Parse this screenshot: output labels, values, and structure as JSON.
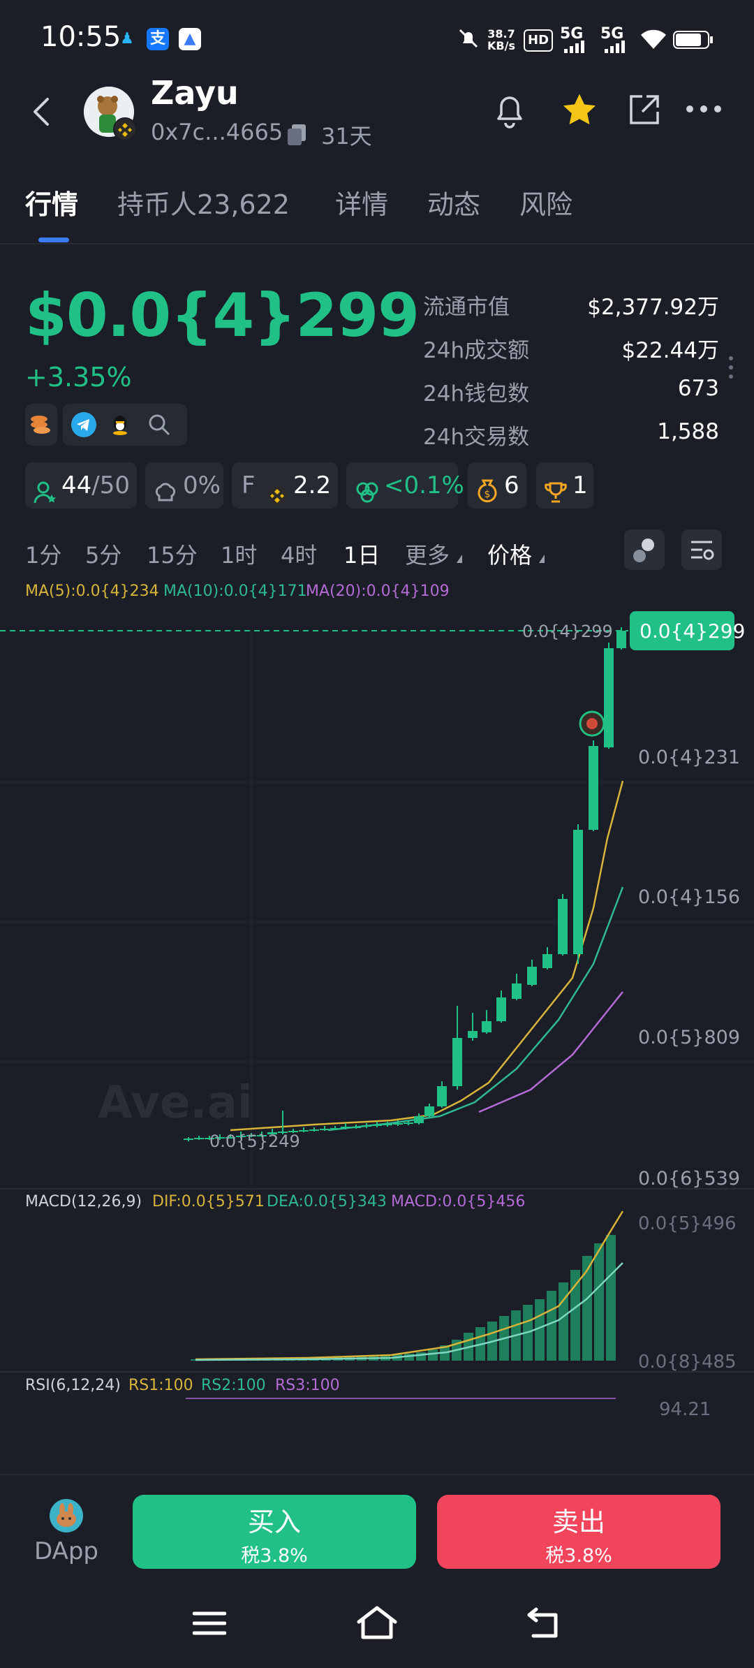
{
  "status_bar": {
    "time": "10:55",
    "net_speed_top": "38.7",
    "net_speed_bottom": "KB/s",
    "hd": "HD",
    "sim1": "5G",
    "sim2": "5G"
  },
  "header": {
    "token_name": "Zayu",
    "address": "0x7c...4665",
    "age": "31天"
  },
  "tabs": [
    {
      "label": "行情"
    },
    {
      "label": "持币人23,622"
    },
    {
      "label": "详情"
    },
    {
      "label": "动态"
    },
    {
      "label": "风险"
    }
  ],
  "market": {
    "price": "$0.0{4}299",
    "change": "+3.35%",
    "stats": [
      {
        "label": "流通市值",
        "value": "$2,377.92万"
      },
      {
        "label": "24h成交额",
        "value": "$22.44万"
      },
      {
        "label": "24h钱包数",
        "value": "673"
      },
      {
        "label": "24h交易数",
        "value": "1,588"
      }
    ]
  },
  "pills": {
    "holders": "44",
    "holders_total": "/50",
    "dev_pct": "0%",
    "f_label": "F",
    "f_value": "2.2",
    "bundle_pct": "<0.1%",
    "money_count": "6",
    "trophy_count": "1"
  },
  "timeframes": [
    "1分",
    "5分",
    "15分",
    "1时",
    "4时",
    "1日",
    "更多",
    "价格"
  ],
  "active_timeframe": "1日",
  "ma": {
    "ma5": "MA(5):0.0{4}234",
    "ma10": "MA(10):0.0{4}171",
    "ma20": "MA(20):0.0{4}109"
  },
  "chart_labels": {
    "current_price_tag": "0.0{4}299",
    "current_price_line_label": "0.0{4}299",
    "y_ticks": [
      "0.0{4}231",
      "0.0{4}156",
      "0.0{5}809",
      "0.0{6}539"
    ],
    "low_label": "0.0{5}249",
    "watermark": "Ave.ai"
  },
  "macd": {
    "title": "MACD(12,26,9)",
    "dif": "DIF:0.0{5}571",
    "dea": "DEA:0.0{5}343",
    "macd": "MACD:0.0{5}456",
    "y_top": "0.0{5}496",
    "y_bottom": "0.0{8}485"
  },
  "rsi": {
    "title": "RSI(6,12,24)",
    "rs1": "RS1:100",
    "rs2": "RS2:100",
    "rs3": "RS3:100",
    "level": "94.21"
  },
  "bottom": {
    "dapp_label": "DApp",
    "buy_label": "买入",
    "buy_tax": "税3.8%",
    "sell_label": "卖出",
    "sell_tax": "税3.8%"
  },
  "colors": {
    "up": "#21c087",
    "down": "#f2445b",
    "accent": "#3b7bf6",
    "ma5": "#d8b43a",
    "ma10": "#2fb894",
    "ma20": "#b56bd6"
  }
}
